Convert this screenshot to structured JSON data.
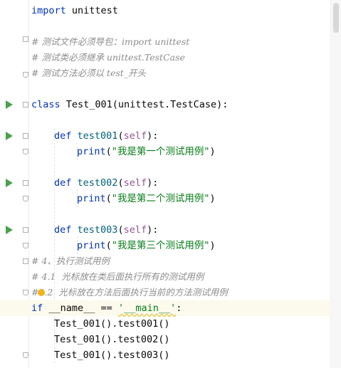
{
  "code": {
    "l1": {
      "kw": "import",
      "rest": " unittest"
    },
    "l2": {
      "text": "# 测试文件必须导包：import unittest"
    },
    "l3": {
      "text": "# 测试类必须继承 unittest.TestCase"
    },
    "l4": {
      "text": "# 测试方法必须以 test_开头"
    },
    "l5": {
      "kw": "class",
      "name": " Test_001(unittest.TestCase):"
    },
    "l6": {
      "kw": "def",
      "name": "test001",
      "open": "(",
      "self": "self",
      "close": "):"
    },
    "l7": {
      "fn": "print",
      "open": "(",
      "str": "\"我是第一个测试用例\"",
      "close": ")"
    },
    "l8": {
      "kw": "def",
      "name": "test002",
      "open": "(",
      "self": "self",
      "close": "):"
    },
    "l9": {
      "fn": "print",
      "open": "(",
      "str": "\"我是第二个测试用例\"",
      "close": ")"
    },
    "l10": {
      "kw": "def",
      "name": "test003",
      "open": "(",
      "self": "self",
      "close": "):"
    },
    "l11": {
      "fn": "print",
      "open": "(",
      "str": "\"我是第三个测试用例\"",
      "close": ")"
    },
    "l12": {
      "text": "# 4、执行测试用例"
    },
    "l13": {
      "text": "# 4.1  光标放在类后面执行所有的测试用例"
    },
    "l14": {
      "text": "#4.2  光标放在方法后面执行当前的方法测试用例"
    },
    "l15": {
      "kw": "if",
      "mid": " __name__ == ",
      "str": "'__main__'",
      "end": ":"
    },
    "l16": {
      "text": "Test_001().test001()"
    },
    "l17": {
      "text": "Test_001().test002()"
    },
    "l18": {
      "text": "Test_001().test003()"
    }
  },
  "icons": {
    "run": "run-arrow-icon",
    "fold": "fold-marker-icon",
    "bulb": "intention-bulb-icon"
  },
  "colors": {
    "keyword": "#0033b3",
    "function": "#00627a",
    "self": "#94558d",
    "string": "#067d17",
    "comment": "#8c8c8c",
    "run": "#4aa14c",
    "current_line": "#fcfaed"
  }
}
